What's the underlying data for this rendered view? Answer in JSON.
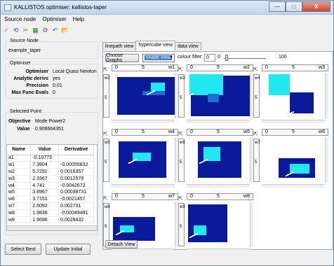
{
  "window": {
    "title": "KALLISTOS optimiser: kallistos-taper",
    "minimize": "—",
    "maximize": "□",
    "close": "X"
  },
  "menu": [
    "Source node",
    "Optimiser",
    "Help"
  ],
  "toolbar": {
    "icons": [
      "run-icon",
      "reset-icon",
      "tools-icon",
      "grid-icon",
      "settings-icon",
      "undo-icon",
      "open-folder-icon"
    ],
    "glyphs": [
      "♂",
      "⟲",
      "✂",
      "▦",
      "⚙",
      "↶",
      "📂"
    ]
  },
  "source_node": {
    "legend": "Source Node",
    "value": "example_taper"
  },
  "optimiser": {
    "legend": "Optimiser",
    "rows": [
      {
        "label": "Optimiser",
        "value": "Local Quasi Newton"
      },
      {
        "label": "Analytic derivs",
        "value": "yes"
      },
      {
        "label": "Precision",
        "value": "0.01"
      },
      {
        "label": "Max Func Evals",
        "value": "0"
      }
    ]
  },
  "selected_point": {
    "legend": "Selected Point",
    "objective_label": "Objective",
    "objective_value": "Mode Power2",
    "value_label": "Value",
    "value_value": "0.906664351",
    "columns": [
      "Name",
      "Value",
      "Derivative"
    ],
    "rows": [
      [
        "a1",
        "-0.10773",
        ""
      ],
      [
        "w1",
        "7.3904",
        "-0.00055832"
      ],
      [
        "w2",
        "5.7291",
        "0.0016357"
      ],
      [
        "w3",
        "2.3367",
        "0.0012578"
      ],
      [
        "w4",
        "4.741",
        "-0.0042672"
      ],
      [
        "w5",
        "3.8967",
        "0.00038731"
      ],
      [
        "w6",
        "3.7151",
        "-0.0021457"
      ],
      [
        "w7",
        "2.6092",
        "0.002731"
      ],
      [
        "w8",
        "1.9836",
        "-0.00049491"
      ],
      [
        "w9",
        "1.9696",
        "0.0029432"
      ]
    ]
  },
  "buttons": {
    "select_best": "Select Best",
    "update_initial": "Update Initial",
    "detach_view": "Detach View"
  },
  "tabs": [
    "linepath view",
    "hypercube view",
    "data view"
  ],
  "active_tab": 1,
  "controls": {
    "choose_graphs": "Choose Graphs",
    "view_mode": "shade view",
    "colour_filter_label": "colour filter:",
    "filter_min": "0",
    "filter_low": "0",
    "filter_max": "100"
  },
  "plots": [
    {
      "var": "w1",
      "ticks": [
        "0",
        "5"
      ],
      "yticks": [
        "w2",
        "5"
      ]
    },
    {
      "var": "w2",
      "ticks": [
        "0",
        "5"
      ],
      "yticks": [
        "w3",
        "5"
      ]
    },
    {
      "var": "w3",
      "ticks": [
        "0",
        "5"
      ],
      "yticks": [
        "w4",
        "5"
      ]
    },
    {
      "var": "w4",
      "ticks": [
        "0",
        "5"
      ],
      "yticks": [
        "w5",
        "5"
      ]
    },
    {
      "var": "w5",
      "ticks": [
        "0",
        "5"
      ],
      "yticks": [
        "w6",
        "5"
      ]
    },
    {
      "var": "w6",
      "ticks": [
        "0",
        "5"
      ],
      "yticks": [
        "w7",
        "5"
      ]
    },
    {
      "var": "w7",
      "ticks": [
        "0",
        "5"
      ],
      "yticks": [
        "w8",
        "5"
      ]
    },
    {
      "var": "w8",
      "ticks": [
        "0",
        "5"
      ],
      "yticks": [
        "w9",
        "5"
      ]
    }
  ],
  "colors": {
    "shade_dark": "#0a1a9a",
    "shade_bright": "#22e8f0",
    "shade_mid": "#1c6ed0",
    "point": "#ffffff"
  }
}
